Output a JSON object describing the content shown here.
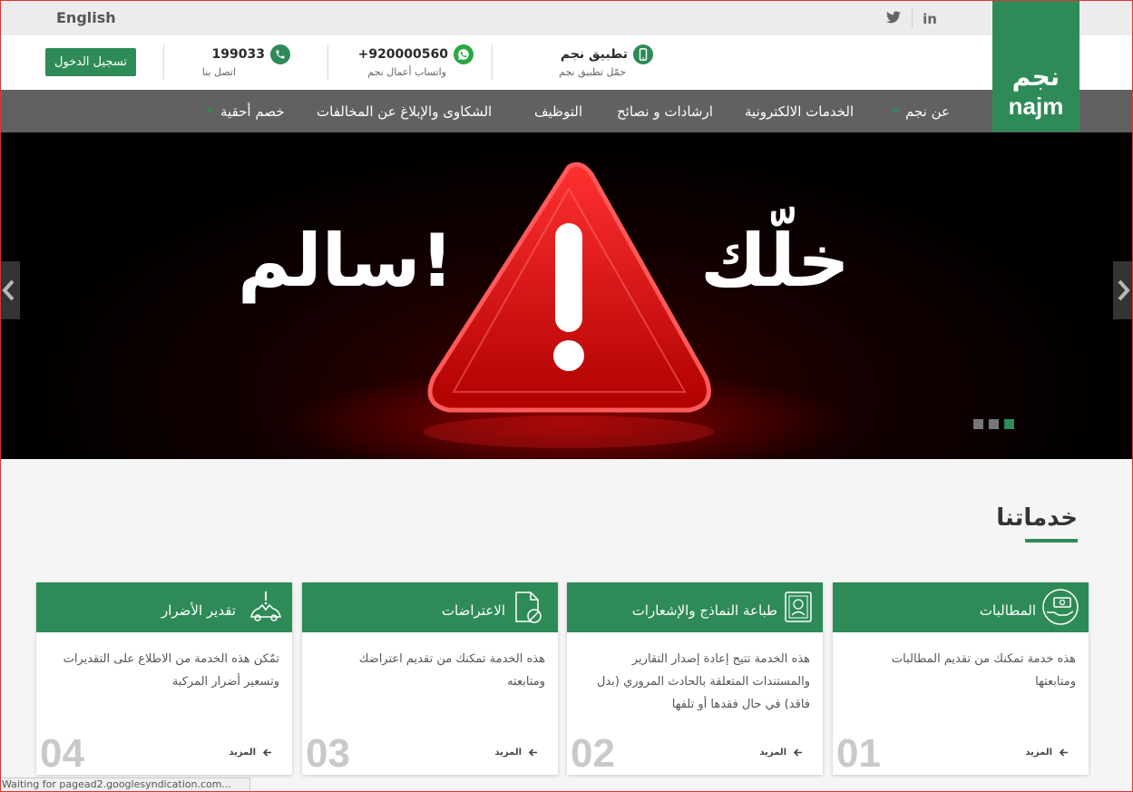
{
  "topbar": {
    "language": "English",
    "social": [
      "twitter-icon",
      "linkedin-icon"
    ],
    "linkedin_label": "in"
  },
  "header": {
    "login_label": "تسجيل الدخول",
    "contacts": [
      {
        "title": "199033",
        "subtitle": "اتصل بنا",
        "icon": "phone-icon"
      },
      {
        "title": "+920000560",
        "subtitle": "واتساب أعمال نجم",
        "icon": "whatsapp-icon"
      },
      {
        "title": "تطبيق نجم",
        "subtitle": "حمّل تطبيق نجم",
        "icon": "mobile-icon"
      }
    ]
  },
  "logo": {
    "arabic": "نجم",
    "latin": "najm"
  },
  "nav": {
    "items": [
      {
        "label": "عن نجم",
        "dropdown": true
      },
      {
        "label": "الخدمات الالكترونية",
        "dropdown": false
      },
      {
        "label": "ارشادات و نصائح",
        "dropdown": false
      },
      {
        "label": "التوظيف",
        "dropdown": false
      },
      {
        "label": "الشكاوى والإبلاغ عن المخالفات",
        "dropdown": false
      },
      {
        "label": "خصم أحقية",
        "dropdown": true
      }
    ]
  },
  "hero": {
    "text_right": "خلّك",
    "text_left": "سالم!",
    "slides": 3,
    "active_slide": 3
  },
  "services": {
    "title": "خدماتنا",
    "more_label": "المزيد",
    "cards": [
      {
        "number": "01",
        "title": "المطالبات",
        "icon": "claims-icon",
        "description": "هذه خدمة تمكنك من تقديم المطالبات ومتابعتها"
      },
      {
        "number": "02",
        "title": "طباعة النماذج والإشعارات",
        "icon": "print-forms-icon",
        "description": "هذه الخدمة تتيح إعادة إصدار التقارير والمستندات المتعلقة بالحادث المروري (بدل فاقد) في حال فقدها أو تلفها"
      },
      {
        "number": "03",
        "title": "الاعتراضات",
        "icon": "objection-icon",
        "description": "هذه الخدمة تمكنك من تقديم اعتراضك ومتابعته"
      },
      {
        "number": "04",
        "title": "تقدير الأضرار",
        "icon": "damage-estimate-icon",
        "description": "تمّكن هذه الخدمة من الاطلاع على التقديرات وتسعير أضرار المركبة"
      }
    ]
  },
  "status_bar": {
    "text": "Waiting for pagead2.googlesyndication.com..."
  },
  "colors": {
    "brand": "#2e8b57",
    "nav_bg": "#616161",
    "topbar_bg": "#ececec"
  }
}
